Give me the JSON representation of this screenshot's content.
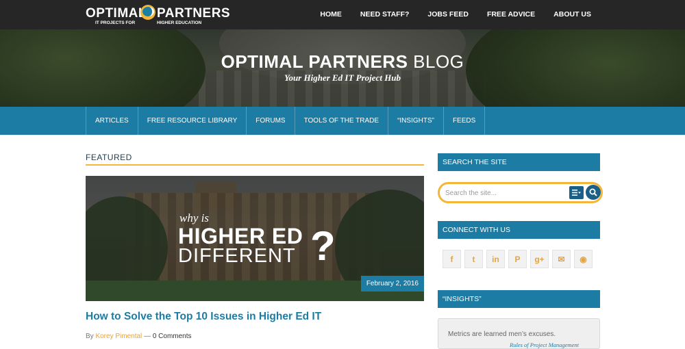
{
  "brand": {
    "name_left": "OPTIMAL",
    "name_right": "PARTNERS",
    "tagline_left": "IT PROJECTS FOR",
    "tagline_right": "HIGHER EDUCATION"
  },
  "top_nav": {
    "items": [
      {
        "label": "HOME"
      },
      {
        "label": "NEED STAFF?"
      },
      {
        "label": "JOBS FEED"
      },
      {
        "label": "FREE ADVICE"
      },
      {
        "label": "ABOUT US"
      }
    ]
  },
  "hero": {
    "title_strong": "OPTIMAL PARTNERS",
    "title_light": "BLOG",
    "subtitle": "Your Higher Ed IT Project Hub"
  },
  "sub_nav": {
    "items": [
      {
        "label": "ARTICLES"
      },
      {
        "label": "FREE RESOURCE LIBRARY"
      },
      {
        "label": "FORUMS"
      },
      {
        "label": "TOOLS OF THE TRADE"
      },
      {
        "label": "“INSIGHTS”"
      },
      {
        "label": "FEEDS"
      }
    ]
  },
  "featured": {
    "heading": "FEATURED",
    "image_text": {
      "why": "why is",
      "line1": "HIGHER ED",
      "line2": "DIFFERENT",
      "mark": "?"
    },
    "date": "February 2, 2016",
    "post_title": "How to Solve the Top 10 Issues in Higher Ed IT",
    "meta_by": "By",
    "author": "Korey Pimental",
    "separator": "—",
    "comments": "0 Comments"
  },
  "sidebar": {
    "search": {
      "heading": "SEARCH THE SITE",
      "placeholder": "Search the site..."
    },
    "connect": {
      "heading": "CONNECT WITH US",
      "icons": [
        {
          "name": "facebook-icon",
          "glyph": "f"
        },
        {
          "name": "twitter-icon",
          "glyph": "t"
        },
        {
          "name": "linkedin-icon",
          "glyph": "in"
        },
        {
          "name": "pinterest-icon",
          "glyph": "P"
        },
        {
          "name": "google-plus-icon",
          "glyph": "g+"
        },
        {
          "name": "email-icon",
          "glyph": "✉"
        },
        {
          "name": "rss-icon",
          "glyph": "◉"
        }
      ]
    },
    "insights": {
      "heading": "“INSIGHTS”",
      "quote": "Metrics are learned men’s excuses.",
      "source": "Rules of Project Management"
    }
  },
  "colors": {
    "accent_blue": "#1c7ca3",
    "accent_gold": "#f4b638",
    "topbar": "#262626"
  }
}
